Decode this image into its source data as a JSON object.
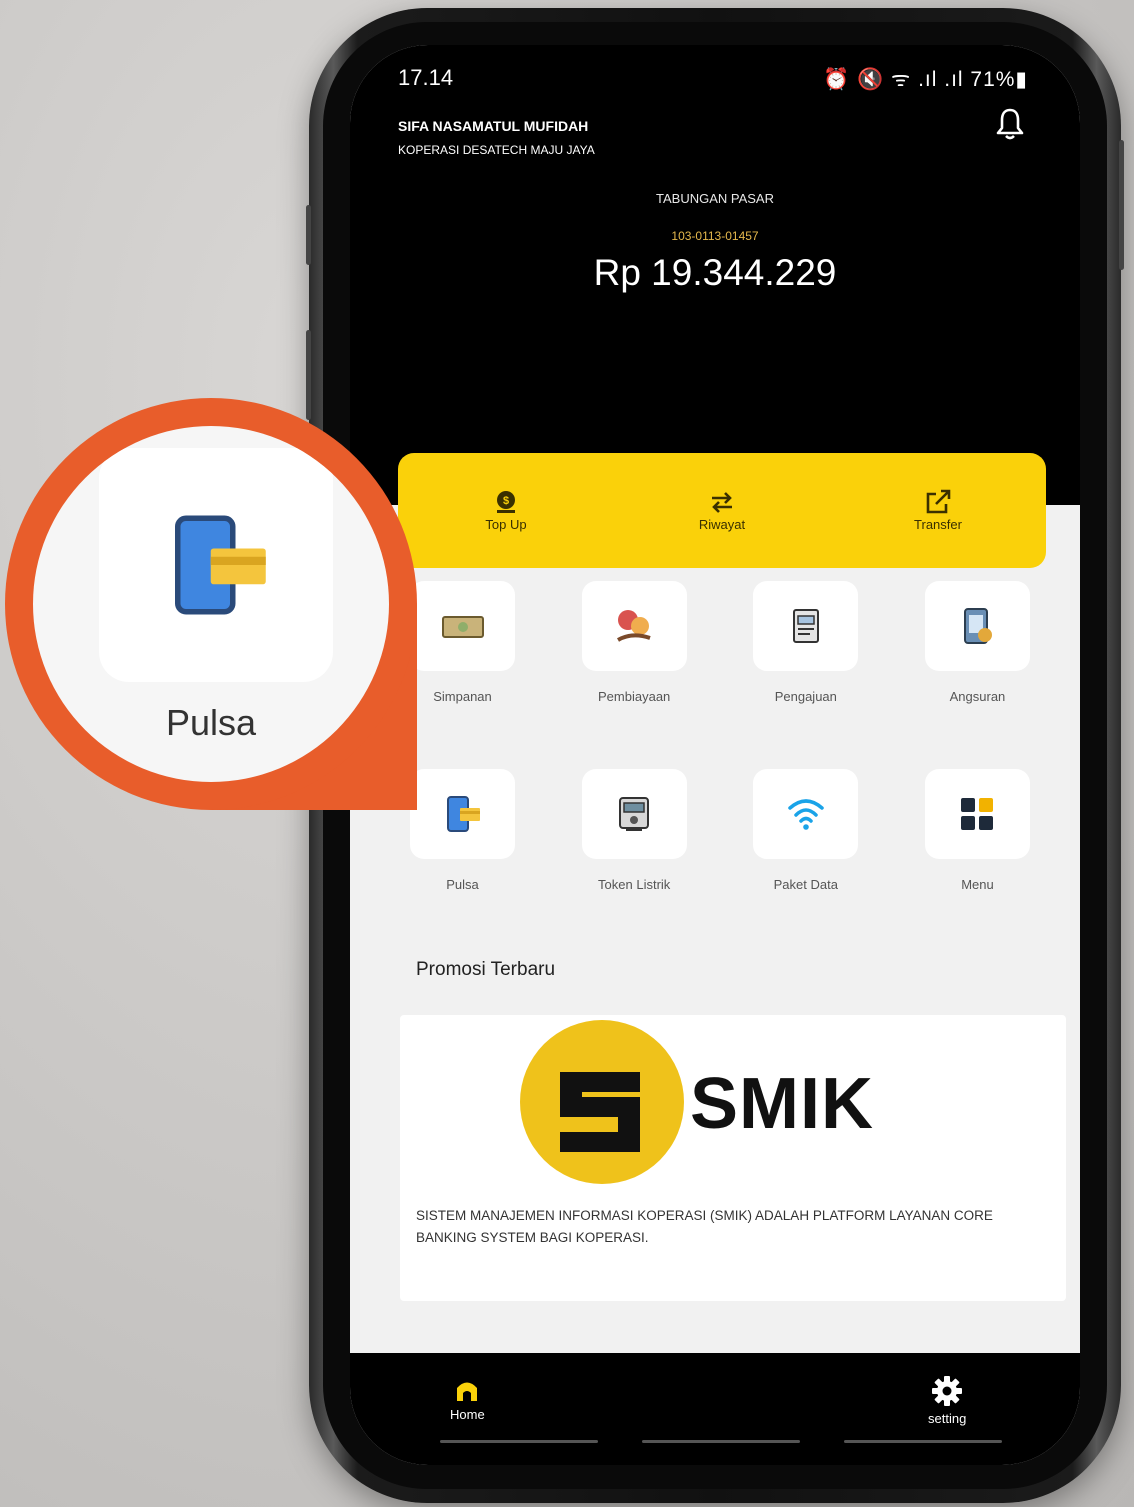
{
  "status_bar": {
    "time": "17.14",
    "right_text": "⏰ 🔇 ᯤ .ıl .ıl 71%▮"
  },
  "header": {
    "user_name": "SIFA NASAMATUL MUFIDAH",
    "coop_name": "KOPERASI DESATECH MAJU JAYA",
    "account_label": "TABUNGAN PASAR",
    "account_number": "103-0113-01457",
    "balance": "Rp 19.344.229"
  },
  "actions": [
    {
      "label": "Top Up",
      "icon": "money-bag-icon"
    },
    {
      "label": "Riwayat",
      "icon": "swap-arrows-icon"
    },
    {
      "label": "Transfer",
      "icon": "external-link-icon"
    }
  ],
  "menu": [
    {
      "label": "Simpanan",
      "icon": "banknote-icon"
    },
    {
      "label": "Pembiayaan",
      "icon": "loan-hand-icon"
    },
    {
      "label": "Pengajuan",
      "icon": "document-form-icon"
    },
    {
      "label": "Angsuran",
      "icon": "installment-icon"
    },
    {
      "label": "Pulsa",
      "icon": "phone-card-icon"
    },
    {
      "label": "Token Listrik",
      "icon": "electric-meter-icon"
    },
    {
      "label": "Paket Data",
      "icon": "wifi-icon"
    },
    {
      "label": "Menu",
      "icon": "grid-menu-icon"
    }
  ],
  "promo": {
    "title": "Promosi Terbaru",
    "brand": "SMIK",
    "description": "SISTEM MANAJEMEN INFORMASI KOPERASI (SMIK) ADALAH PLATFORM LAYANAN CORE BANKING SYSTEM BAGI KOPERASI."
  },
  "bottom_nav": {
    "home": "Home",
    "setting": "setting"
  },
  "callout": {
    "label": "Pulsa",
    "icon": "phone-card-icon"
  },
  "colors": {
    "accent": "#fad10a",
    "callout": "#e85d2b",
    "account_number": "#e6b94d",
    "header_bg": "#000000"
  }
}
